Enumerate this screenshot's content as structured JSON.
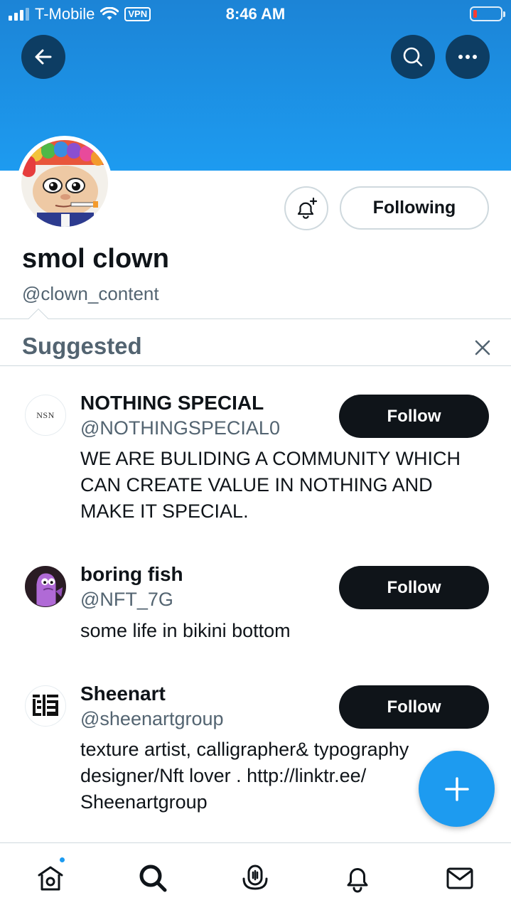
{
  "status_bar": {
    "carrier": "T-Mobile",
    "vpn_label": "VPN",
    "time": "8:46 AM"
  },
  "profile": {
    "display_name": "smol clown",
    "handle": "@clown_content",
    "following_label": "Following"
  },
  "suggested": {
    "title": "Suggested",
    "items": [
      {
        "name": "NOTHING SPECIAL",
        "handle": "@NOTHINGSPECIAL0",
        "bio": "WE ARE BULIDING A COMMUNITY WHICH CAN CREATE VALUE IN NOTHING AND MAKE IT SPECIAL.",
        "avatar_text": "NSN",
        "follow_label": "Follow"
      },
      {
        "name": "boring fish",
        "handle": "@NFT_7G",
        "bio": "some life in bikini bottom",
        "follow_label": "Follow"
      },
      {
        "name": "Sheenart",
        "handle": "@sheenartgroup",
        "bio": "texture artist, calligrapher& typography designer/Nft lover . http://linktr.ee/ Sheenartgroup",
        "follow_label": "Follow"
      }
    ]
  },
  "colors": {
    "accent": "#1d9bf0",
    "text": "#0f1419",
    "secondary_text": "#536471",
    "border": "#cfd9de"
  },
  "icons": {
    "back": "arrow-left-icon",
    "search": "search-icon",
    "more": "more-icon",
    "bell": "bell-plus-icon",
    "dismiss": "close-icon",
    "compose": "plus-icon",
    "tabs": [
      "home-icon",
      "search-icon",
      "spaces-icon",
      "notifications-icon",
      "messages-icon"
    ]
  }
}
